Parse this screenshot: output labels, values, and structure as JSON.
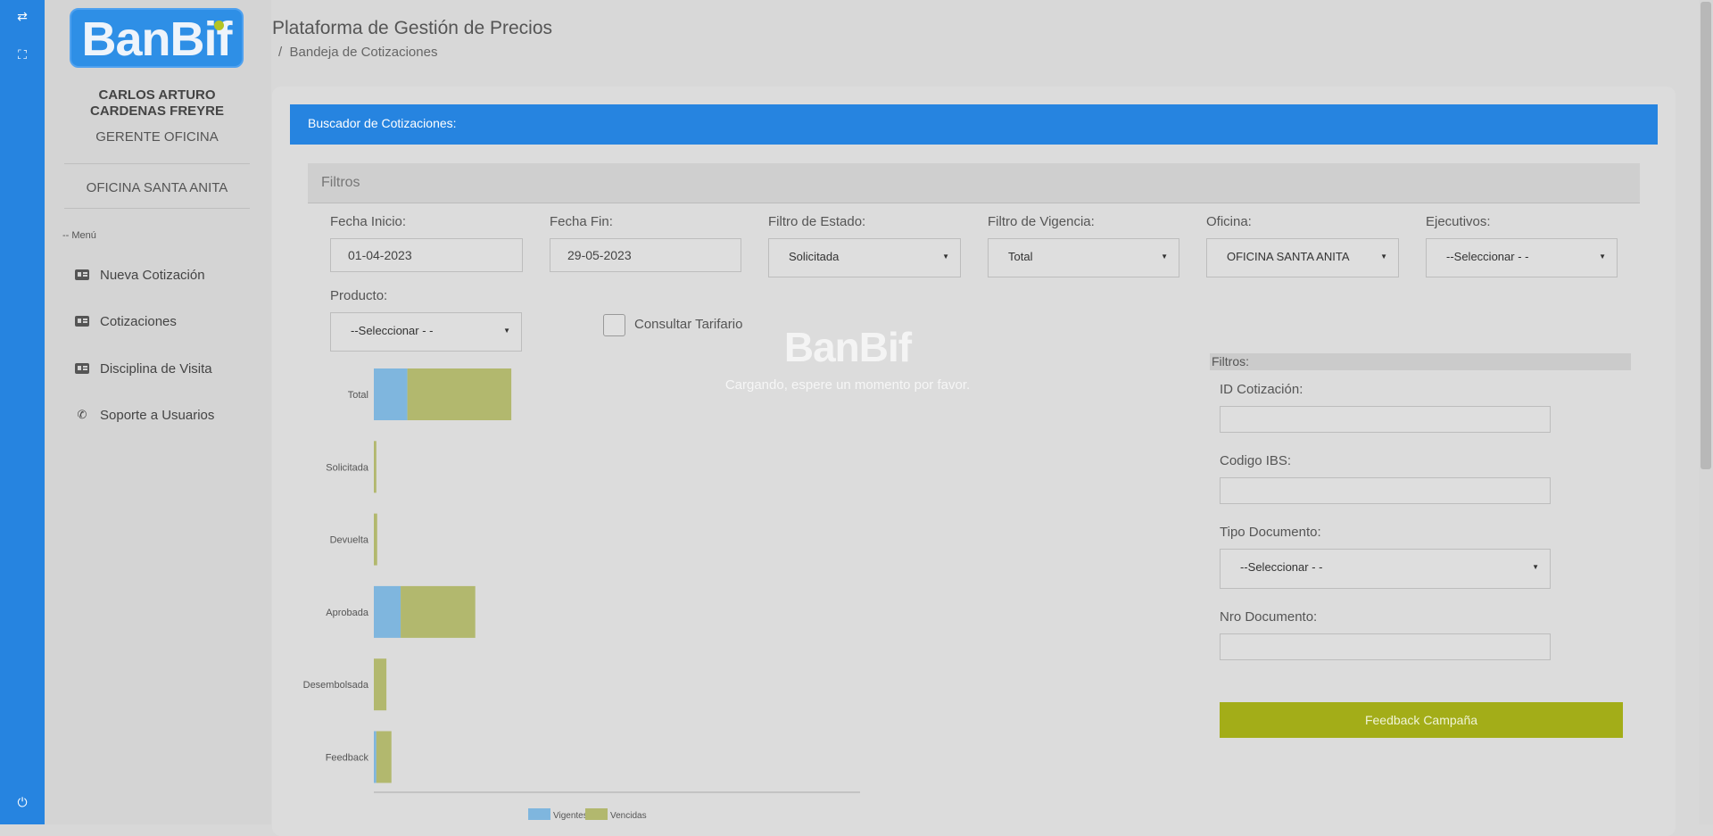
{
  "app": {
    "title": "Plataforma de Gestión de Precios",
    "breadcrumb_sep": "/",
    "breadcrumb": "Bandeja de Cotizaciones",
    "logo_text": "BanBif"
  },
  "user": {
    "name_line1": "CARLOS ARTURO",
    "name_line2": "CARDENAS FREYRE",
    "role": "GERENTE OFICINA",
    "office": "OFICINA SANTA ANITA"
  },
  "menu": {
    "title": "-- Menú",
    "items": [
      {
        "label": "Nueva Cotización",
        "icon": "id-card-icon"
      },
      {
        "label": "Cotizaciones",
        "icon": "id-card-icon"
      },
      {
        "label": "Disciplina de Visita",
        "icon": "id-card-icon"
      },
      {
        "label": "Soporte a Usuarios",
        "icon": "phone-icon"
      }
    ]
  },
  "strip_icons": [
    "swap-arrows-icon",
    "fullscreen-icon",
    "power-icon"
  ],
  "card": {
    "header": "Buscador de Cotizaciones:",
    "filters_title": "Filtros"
  },
  "filters": {
    "fecha_inicio": {
      "label": "Fecha Inicio:",
      "value": "01-04-2023"
    },
    "fecha_fin": {
      "label": "Fecha Fin:",
      "value": "29-05-2023"
    },
    "estado": {
      "label": "Filtro de Estado:",
      "value": "Solicitada"
    },
    "vigencia": {
      "label": "Filtro de Vigencia:",
      "value": "Total"
    },
    "oficina": {
      "label": "Oficina:",
      "value": "OFICINA SANTA ANITA"
    },
    "ejecutivos": {
      "label": "Ejecutivos:",
      "value": "--Seleccionar - -"
    },
    "producto": {
      "label": "Producto:",
      "value": "--Seleccionar - -"
    },
    "tarifario": {
      "label": "Consultar Tarifario",
      "checked": false
    }
  },
  "loading": {
    "logo": "BanBif",
    "message": "Cargando, espere un momento por favor."
  },
  "right_filters": {
    "title": "Filtros:",
    "id_cotizacion": {
      "label": "ID Cotización:",
      "value": ""
    },
    "codigo_ibs": {
      "label": "Codigo IBS:",
      "value": ""
    },
    "tipo_documento": {
      "label": "Tipo Documento:",
      "value": "--Seleccionar - -"
    },
    "nro_documento": {
      "label": "Nro Documento:",
      "value": ""
    },
    "feedback_button": "Feedback Campaña"
  },
  "colors": {
    "brand_blue": "#2684e0",
    "vigentes": "#7fb6de",
    "vencidas": "#b2b86e",
    "feedback_button": "#a3ad18"
  },
  "chart_data": {
    "type": "bar",
    "orientation": "horizontal",
    "stacked": true,
    "categories": [
      "Total",
      "Solicitada",
      "Devuelta",
      "Aprobada",
      "Desembolsada",
      "Feedback"
    ],
    "series": [
      {
        "name": "Vigentes",
        "color": "#7fb6de",
        "values": [
          40,
          0,
          0,
          32,
          0,
          3
        ]
      },
      {
        "name": "Vencidas",
        "color": "#b2b86e",
        "values": [
          124,
          3,
          4,
          89,
          15,
          18
        ]
      }
    ],
    "x_max": 580,
    "legend": "bottom",
    "grid": false
  }
}
